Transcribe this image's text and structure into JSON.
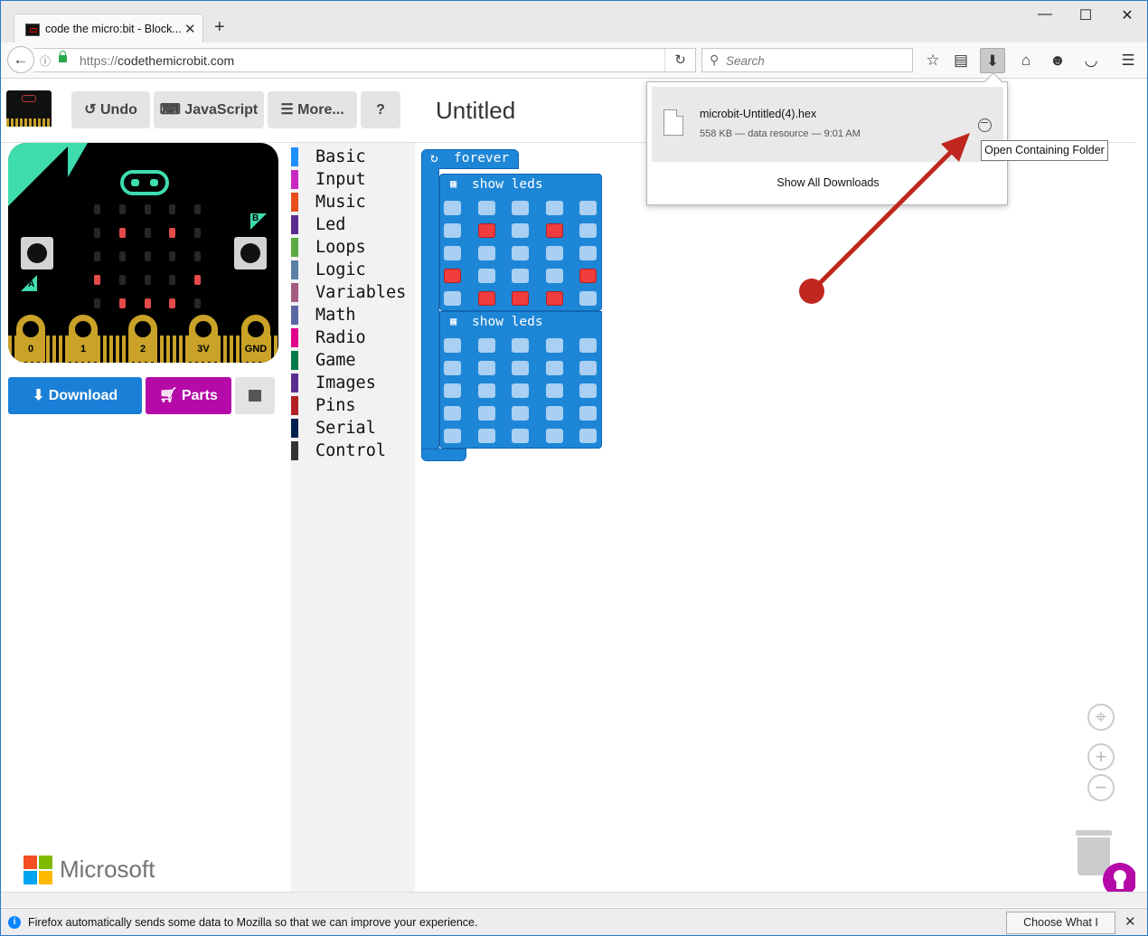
{
  "browser": {
    "tab_title": "code the micro:bit - Block...",
    "tab_close": "✕",
    "new_tab": "+",
    "window_minimize": "—",
    "window_maximize": "☐",
    "window_close": "✕",
    "url_scheme": "https://",
    "url_host": "codethemicrobit.com",
    "search_placeholder": "Search"
  },
  "header": {
    "undo_label": "Undo",
    "javascript_label": "JavaScript",
    "more_label": "More...",
    "help_label": "?",
    "project_title": "Untitled"
  },
  "simulator": {
    "pin_labels": [
      "0",
      "1",
      "2",
      "3V",
      "GND"
    ],
    "button_a": "A",
    "button_b": "B",
    "leds": [
      [
        0,
        0,
        0,
        0,
        0
      ],
      [
        0,
        1,
        0,
        1,
        0
      ],
      [
        0,
        0,
        0,
        0,
        0
      ],
      [
        1,
        0,
        0,
        0,
        1
      ],
      [
        0,
        1,
        1,
        1,
        0
      ]
    ]
  },
  "actions": {
    "download_label": "Download",
    "parts_label": "Parts"
  },
  "toolbox": {
    "categories": [
      {
        "label": "Basic",
        "color": "#1e90ff"
      },
      {
        "label": "Input",
        "color": "#c729c0"
      },
      {
        "label": "Music",
        "color": "#e84f1c"
      },
      {
        "label": "Led",
        "color": "#5c2d91"
      },
      {
        "label": "Loops",
        "color": "#58ab41"
      },
      {
        "label": "Logic",
        "color": "#5b80a5"
      },
      {
        "label": "Variables",
        "color": "#a55b80"
      },
      {
        "label": "Math",
        "color": "#5b67a5"
      },
      {
        "label": "Radio",
        "color": "#e3008c"
      },
      {
        "label": "Game",
        "color": "#007a4b"
      },
      {
        "label": "Images",
        "color": "#5c2d91"
      },
      {
        "label": "Pins",
        "color": "#b22222"
      },
      {
        "label": "Serial",
        "color": "#002050"
      },
      {
        "label": "Control",
        "color": "#333333"
      }
    ]
  },
  "workspace": {
    "forever_label": "forever",
    "show_leds_label": "show leds",
    "grid1": [
      [
        0,
        0,
        0,
        0,
        0
      ],
      [
        0,
        1,
        0,
        1,
        0
      ],
      [
        0,
        0,
        0,
        0,
        0
      ],
      [
        1,
        0,
        0,
        0,
        1
      ],
      [
        0,
        1,
        1,
        1,
        0
      ]
    ],
    "grid2": [
      [
        0,
        0,
        0,
        0,
        0
      ],
      [
        0,
        0,
        0,
        0,
        0
      ],
      [
        0,
        0,
        0,
        0,
        0
      ],
      [
        0,
        0,
        0,
        0,
        0
      ],
      [
        0,
        0,
        0,
        0,
        0
      ]
    ]
  },
  "footer": {
    "microsoft_label": "Microsoft"
  },
  "downloads": {
    "file_name": "microbit-Untitled(4).hex",
    "file_meta": "558 KB — data resource — 9:01 AM",
    "show_all": "Show All Downloads",
    "tooltip": "Open Containing Folder"
  },
  "notification": {
    "message": "Firefox automatically sends some data to Mozilla so that we can improve your experience.",
    "choose_button": "Choose What I Share",
    "close": "✕"
  },
  "colors": {
    "download_button": "#1a7fd6",
    "parts_button": "#b509a8",
    "block_blue": "#1e86d6",
    "annotation_arrow": "#c0271e"
  }
}
